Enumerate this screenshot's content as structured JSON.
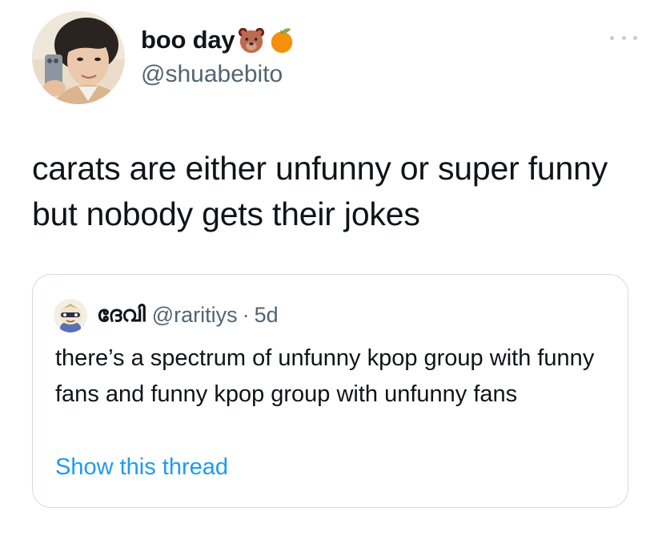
{
  "author": {
    "display_name": "boo day",
    "name_emojis": [
      "bear-face-emoji",
      "tangerine-emoji"
    ],
    "handle": "@shuabebito",
    "avatar": "profile-photo-avatar"
  },
  "more_menu": {
    "icon": "more-horizontal-icon"
  },
  "tweet": {
    "text": "carats are either unfunny or super funny but nobody gets their jokes"
  },
  "quoted_tweet": {
    "display_name": "ദേവി",
    "handle": "@raritiys",
    "separator": "·",
    "time": "5d",
    "text": "there’s a spectrum of unfunny kpop group with funny fans and funny kpop group with unfunny fans",
    "show_thread_label": "Show this thread",
    "avatar": "cartoon-character-avatar"
  },
  "colors": {
    "text_primary": "#0f1419",
    "text_secondary": "#536471",
    "link": "#1d9bf0",
    "card_border": "#d5dbe0"
  }
}
